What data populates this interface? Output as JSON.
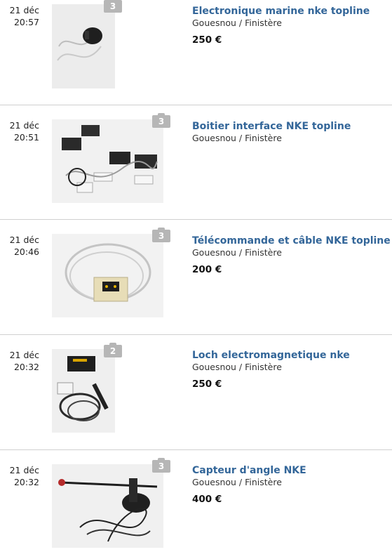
{
  "listings": [
    {
      "day": "21 déc",
      "time": "20:57",
      "photos": "3",
      "title": "Electronique marine nke topline",
      "location": "Gouesnou / Finistère",
      "price": "250 €"
    },
    {
      "day": "21 déc",
      "time": "20:51",
      "photos": "3",
      "title": "Boitier interface NKE topline",
      "location": "Gouesnou / Finistère",
      "price": ""
    },
    {
      "day": "21 déc",
      "time": "20:46",
      "photos": "3",
      "title": "Télécommande et câble NKE topline",
      "location": "Gouesnou / Finistère",
      "price": "200 €"
    },
    {
      "day": "21 déc",
      "time": "20:32",
      "photos": "2",
      "title": "Loch electromagnetique nke",
      "location": "Gouesnou / Finistère",
      "price": "250 €"
    },
    {
      "day": "21 déc",
      "time": "20:32",
      "photos": "3",
      "title": "Capteur d'angle NKE",
      "location": "Gouesnou / Finistère",
      "price": "400 €"
    }
  ]
}
